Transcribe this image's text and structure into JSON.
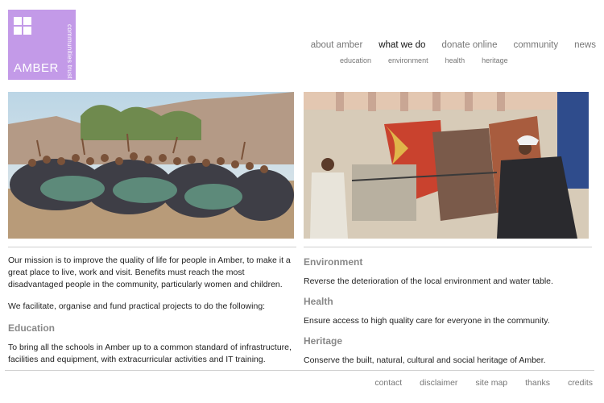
{
  "logo": {
    "word": "AMBER",
    "tagline": "communities trust",
    "color": "#c39ae8"
  },
  "nav": {
    "items": [
      "about amber",
      "what we do",
      "donate online",
      "community",
      "news"
    ],
    "active": "what we do"
  },
  "subnav": {
    "items": [
      "education",
      "environment",
      "health",
      "heritage"
    ]
  },
  "main": {
    "mission": "Our mission is to improve the quality of life for people in Amber, to make it a great place to live, work and visit. Benefits must reach the most disadvantaged people in the community, particularly women and children.",
    "facilitate": "We facilitate, organise and fund practical projects to do the following:",
    "sections": [
      {
        "title": "Education",
        "body": "To bring all the schools in Amber up to a common standard of infrastructure, facilities and equipment, with extracurricular activities and IT training."
      },
      {
        "title": "Environment",
        "body": "Reverse the deterioration of the local environment and water table."
      },
      {
        "title": "Health",
        "body": "Ensure access to high quality care for everyone in the community."
      },
      {
        "title": "Heritage",
        "body": "Conserve the built, natural, cultural and social heritage of Amber."
      }
    ]
  },
  "footer": {
    "links": [
      "contact",
      "disclaimer",
      "site map",
      "thanks",
      "credits"
    ]
  }
}
